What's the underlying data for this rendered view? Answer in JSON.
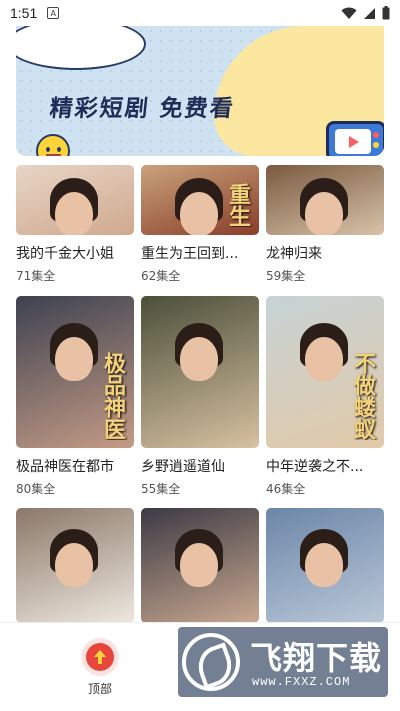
{
  "status_bar": {
    "time": "1:51",
    "notification_letter": "A"
  },
  "banner": {
    "title": "精彩短剧 免费看",
    "accent": "#fce7a0",
    "bg": "#cfe2f1"
  },
  "dramas": [
    {
      "title": "我的千金大小姐",
      "episodes": "71集全",
      "palette": [
        "#e7d5c6",
        "#cfa98e"
      ]
    },
    {
      "title": "重生为王回到...",
      "episodes": "62集全",
      "palette": [
        "#c9a37c",
        "#8a3d2a"
      ],
      "overlay": "重生"
    },
    {
      "title": "龙神归来",
      "episodes": "59集全",
      "palette": [
        "#7a5a40",
        "#d7c3a8"
      ]
    },
    {
      "title": "极品神医在都市",
      "episodes": "80集全",
      "palette": [
        "#3d4250",
        "#c49b85"
      ],
      "overlay": "极品神医"
    },
    {
      "title": "乡野逍遥道仙",
      "episodes": "55集全",
      "palette": [
        "#4b4f3a",
        "#d7c1a0"
      ]
    },
    {
      "title": "中年逆袭之不...",
      "episodes": "46集全",
      "palette": [
        "#c7d3d6",
        "#e2c9a8"
      ],
      "overlay": "不做蝼蚁"
    },
    {
      "title": "",
      "episodes": "",
      "palette": [
        "#8a7868",
        "#efe8e0"
      ]
    },
    {
      "title": "",
      "episodes": "",
      "palette": [
        "#3b3a44",
        "#c9a890"
      ]
    },
    {
      "title": "",
      "episodes": "",
      "palette": [
        "#6c86a8",
        "#b9c8d8"
      ]
    }
  ],
  "bottom": {
    "top_label": "顶部",
    "accent": "#e8453c"
  },
  "watermark": {
    "brand": "飞翔下载",
    "url": "www.FXXZ.COM"
  }
}
